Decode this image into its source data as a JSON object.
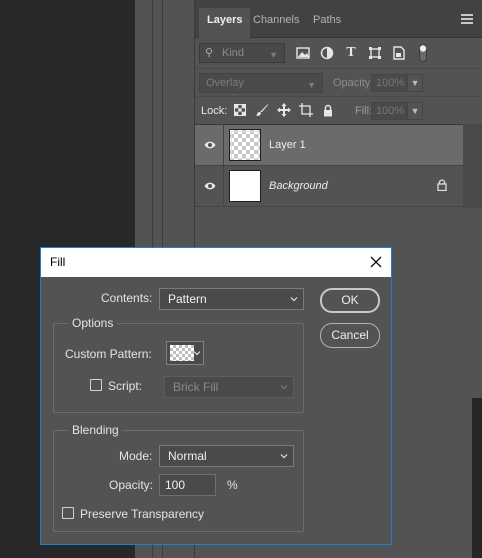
{
  "layers_panel": {
    "tabs": [
      {
        "label": "Layers"
      },
      {
        "label": "Channels"
      },
      {
        "label": "Paths"
      }
    ],
    "filter": {
      "kind_placeholder": "Kind"
    },
    "blend_mode": "Overlay",
    "opacity_label": "Opacity:",
    "opacity_value": "100%",
    "lock_label": "Lock:",
    "fill_label": "Fill:",
    "fill_value": "100%",
    "layers": [
      {
        "name": "Layer 1",
        "selected": true
      },
      {
        "name": "Background",
        "selected": false,
        "locked": true
      }
    ]
  },
  "fill_dialog": {
    "title": "Fill",
    "contents_label": "Contents:",
    "contents_value": "Pattern",
    "options_group": "Options",
    "custom_pattern_label": "Custom Pattern:",
    "script_label": "Script:",
    "script_value": "Brick Fill",
    "script_checked": false,
    "blending_group": "Blending",
    "mode_label": "Mode:",
    "mode_value": "Normal",
    "opacity_label": "Opacity:",
    "opacity_value": "100",
    "opacity_unit": "%",
    "preserve_label": "Preserve Transparency",
    "preserve_checked": false,
    "ok_label": "OK",
    "cancel_label": "Cancel"
  },
  "colors": {
    "panel_bg": "#535353",
    "selected_row": "#6b6b6b",
    "dialog_border": "#1e7fcf"
  }
}
